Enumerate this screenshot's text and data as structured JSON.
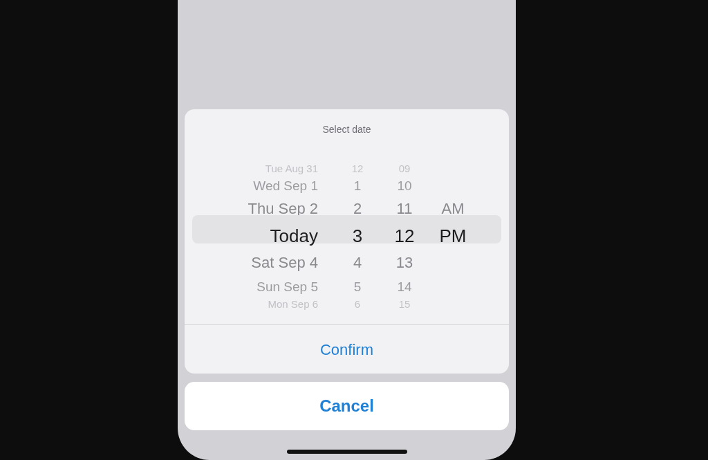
{
  "sheet": {
    "title": "Select date",
    "rows": [
      {
        "date": "Tue Aug 31",
        "hour": "12",
        "minute": "09",
        "selected": false
      },
      {
        "date": "Wed Sep 1",
        "hour": "1",
        "minute": "10",
        "selected": false
      },
      {
        "date": "Thu Sep 2",
        "hour": "2",
        "minute": "11",
        "period": "AM",
        "selected": false
      },
      {
        "date": "Today",
        "hour": "3",
        "minute": "12",
        "period": "PM",
        "selected": true
      },
      {
        "date": "Sat Sep 4",
        "hour": "4",
        "minute": "13",
        "selected": false
      },
      {
        "date": "Sun Sep 5",
        "hour": "5",
        "minute": "14",
        "selected": false
      },
      {
        "date": "Mon Sep 6",
        "hour": "6",
        "minute": "15",
        "selected": false
      }
    ],
    "confirm": "Confirm"
  },
  "cancel": "Cancel"
}
